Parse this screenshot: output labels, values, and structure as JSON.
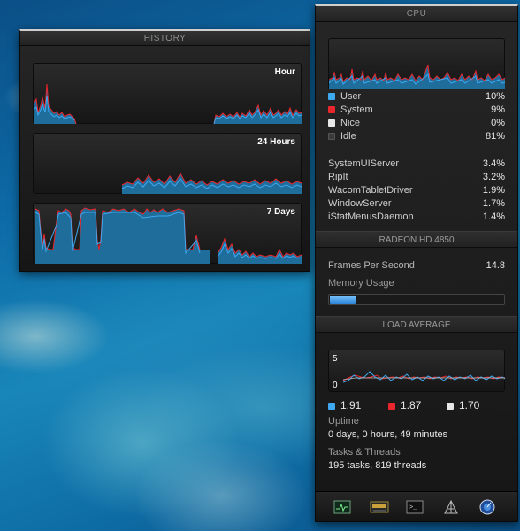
{
  "history": {
    "title": "HISTORY",
    "graphs": [
      {
        "label": "Hour"
      },
      {
        "label": "24 Hours"
      },
      {
        "label": "7 Days"
      }
    ]
  },
  "cpu": {
    "title": "CPU",
    "usage": [
      {
        "label": "User",
        "value": "10%",
        "color": "#3ea8f0"
      },
      {
        "label": "System",
        "value": "9%",
        "color": "#e8262c"
      },
      {
        "label": "Nice",
        "value": "0%",
        "color": "#e6e6e6"
      },
      {
        "label": "Idle",
        "value": "81%",
        "color": "#3a3a3a"
      }
    ],
    "processes": [
      {
        "name": "SystemUIServer",
        "value": "3.4%"
      },
      {
        "name": "RipIt",
        "value": "3.2%"
      },
      {
        "name": "WacomTabletDriver",
        "value": "1.9%"
      },
      {
        "name": "WindowServer",
        "value": "1.7%"
      },
      {
        "name": "iStatMenusDaemon",
        "value": "1.4%"
      }
    ]
  },
  "gpu": {
    "title": "RADEON HD 4850",
    "fps_label": "Frames Per Second",
    "fps_value": "14.8",
    "memory_label": "Memory Usage",
    "memory_fraction": 0.15
  },
  "load": {
    "title": "LOAD AVERAGE",
    "axis_max": "5",
    "axis_min": "0",
    "values": [
      {
        "value": "1.91",
        "color": "#3ea8f0"
      },
      {
        "value": "1.87",
        "color": "#e8262c"
      },
      {
        "value": "1.70",
        "color": "#e6e6e6"
      }
    ]
  },
  "uptime": {
    "label": "Uptime",
    "value": "0 days, 0 hours, 49 minutes"
  },
  "tasks": {
    "label": "Tasks & Threads",
    "value": "195 tasks, 819 threads"
  },
  "toolbar": {
    "icons": [
      "activity-monitor-icon",
      "system-profiler-icon",
      "terminal-icon",
      "console-icon",
      "istat-icon"
    ]
  }
}
